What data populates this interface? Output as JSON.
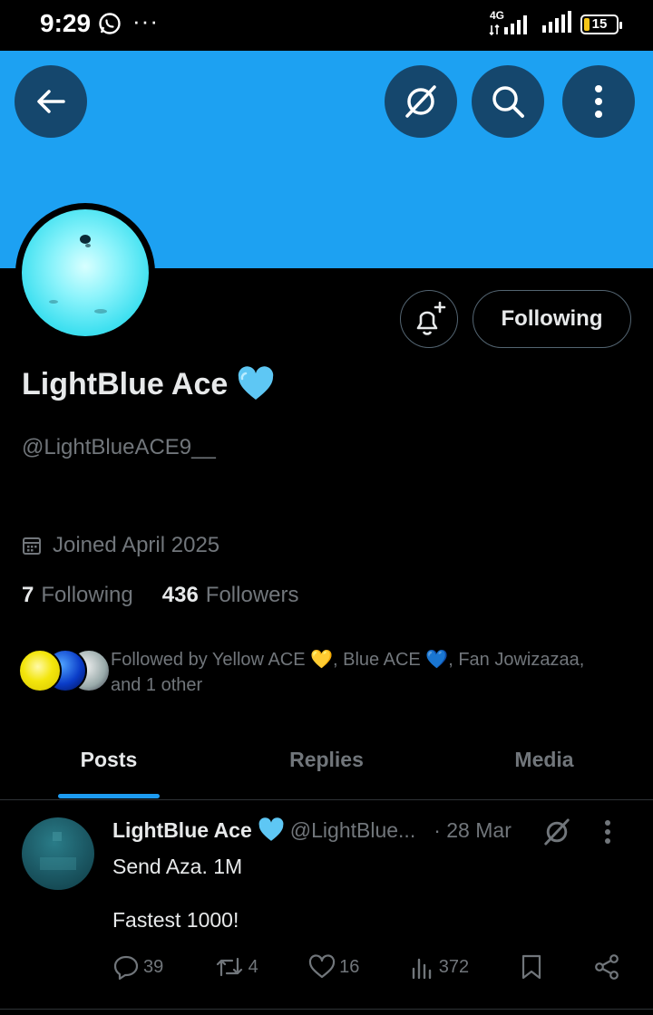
{
  "status_bar": {
    "time": "9:29",
    "network": "4G",
    "battery": "15"
  },
  "profile": {
    "name": "LightBlue Ace",
    "name_emoji": "light-blue-heart",
    "handle": "@LightBlueACE9__",
    "joined": "Joined April 2025",
    "following_count": "7",
    "following_label": "Following",
    "followers_count": "436",
    "followers_label": "Followers",
    "follow_button_label": "Following",
    "followed_by": "Followed by Yellow ACE 💛, Blue ACE 💙, Fan Jowizazaa, and 1 other"
  },
  "tabs": [
    {
      "label": "Posts",
      "active": true
    },
    {
      "label": "Replies",
      "active": false
    },
    {
      "label": "Media",
      "active": false
    }
  ],
  "post": {
    "name": "LightBlue Ace",
    "handle": "@LightBlue...",
    "date": "· 28 Mar",
    "line1": "Send Aza. 1M",
    "line2": "Fastest 1000!",
    "replies": "39",
    "reposts": "4",
    "likes": "16",
    "views": "372"
  },
  "colors": {
    "banner": "#1da1f2",
    "accent": "#1d9bf0",
    "muted_text": "#71767b",
    "heart": "#5ec7f4"
  },
  "icons": [
    "back-arrow-icon",
    "grok-icon",
    "search-icon",
    "more-vertical-icon",
    "notification-bell-icon",
    "calendar-icon",
    "reply-icon",
    "repost-icon",
    "like-icon",
    "views-icon",
    "bookmark-icon",
    "share-icon"
  ]
}
